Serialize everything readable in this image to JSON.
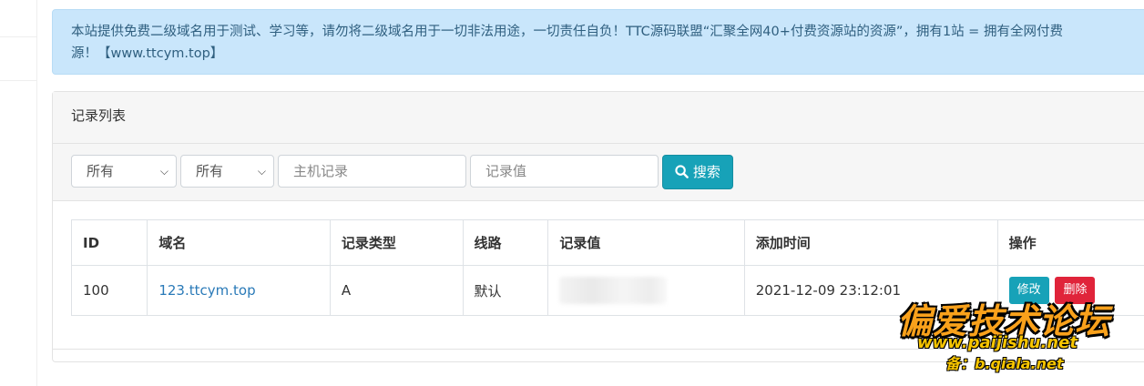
{
  "notice": {
    "line1": "本站提供免费二级域名用于测试、学习等，请勿将二级域名用于一切非法用途，一切责任自负！TTC源码联盟“汇聚全网40+付费资源站的资源”，拥有1站 = 拥有全网付费",
    "line2": "源！【www.ttcym.top】"
  },
  "panel": {
    "title": "记录列表"
  },
  "filters": {
    "select1": "所有",
    "select2": "所有",
    "host_placeholder": "主机记录",
    "value_placeholder": "记录值",
    "search_label": "搜索"
  },
  "table": {
    "headers": {
      "id": "ID",
      "domain": "域名",
      "type": "记录类型",
      "line": "线路",
      "value": "记录值",
      "time": "添加时间",
      "ops": "操作"
    },
    "rows": [
      {
        "id": "100",
        "domain": "123.ttcym.top",
        "type": "A",
        "line": "默认",
        "time": "2021-12-09 23:12:01",
        "edit": "修改",
        "del": "删除"
      }
    ]
  },
  "watermark": {
    "title": "偏爱技术论坛",
    "url": "www.paijishu.net",
    "backup": "备：b.qiala.net"
  },
  "colors": {
    "accent": "#17a2b8",
    "danger": "#e0243a",
    "link": "#2a7ab8",
    "alert_bg": "#c9e6fb"
  }
}
